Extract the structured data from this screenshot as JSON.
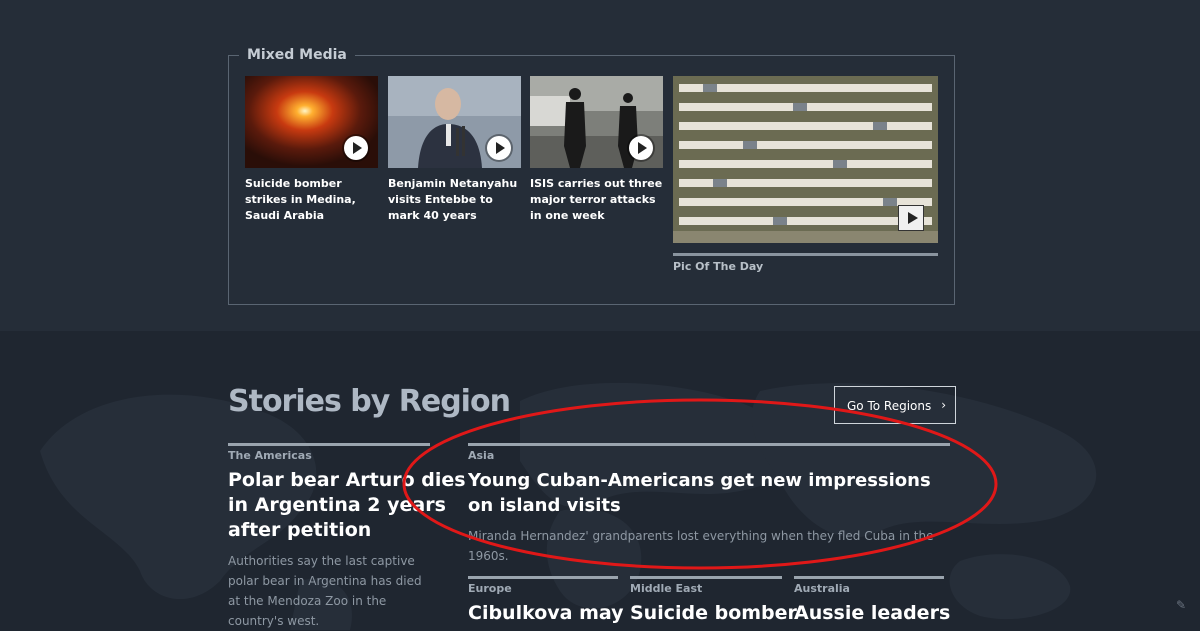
{
  "mixed_media": {
    "title": "Mixed Media",
    "items": [
      {
        "caption": "Suicide bomber strikes in Medina, Saudi Arabia"
      },
      {
        "caption": "Benjamin Netanyahu visits Entebbe to mark 40 years"
      },
      {
        "caption": "ISIS carries out three major terror attacks in one week"
      }
    ],
    "pic_of_the_day": {
      "label": "Pic Of The Day"
    }
  },
  "stories_by_region": {
    "title": "Stories by Region",
    "go_button": "Go To Regions",
    "americas": {
      "label": "The Americas",
      "headline": "Polar bear Arturo dies in Argentina 2 years after petition",
      "summary": "Authorities say the last captive polar bear in Argentina has died at the Mendoza Zoo in the country's west."
    },
    "asia": {
      "label": "Asia",
      "headline": "Young Cuban-Americans get new impressions on island visits",
      "summary": "Miranda Hernandez' grandparents lost everything when they fled Cuba in the 1960s."
    },
    "europe": {
      "label": "Europe",
      "headline": "Cibulkova may"
    },
    "middle_east": {
      "label": "Middle East",
      "headline": "Suicide bomber"
    },
    "australia": {
      "label": "Australia",
      "headline": "Aussie leaders"
    }
  },
  "annotation": {
    "color": "#e01818"
  }
}
